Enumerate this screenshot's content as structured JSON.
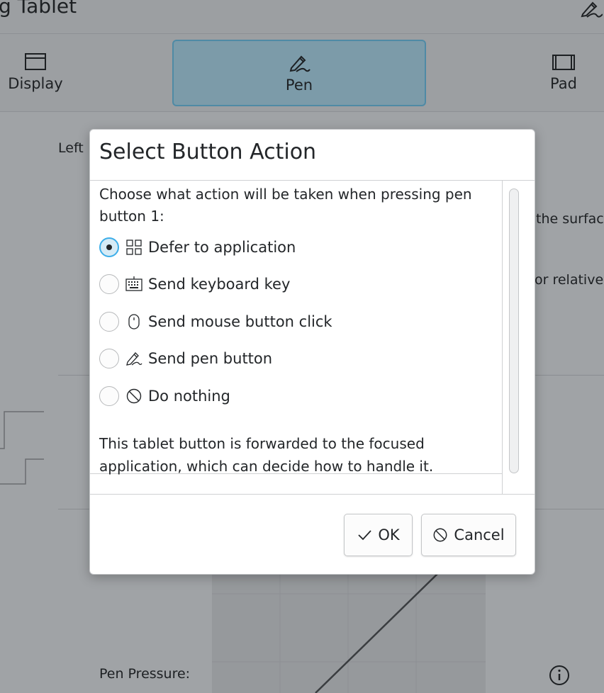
{
  "window": {
    "title": "g Tablet",
    "title_icon": "pen-icon"
  },
  "tabs": [
    {
      "label": "Display",
      "icon": "display-icon"
    },
    {
      "label": "Pen",
      "icon": "pen-icon",
      "selected": true
    },
    {
      "label": "Pad",
      "icon": "pad-icon"
    }
  ],
  "background": {
    "left_label": "Left",
    "surface_text": "the surfac",
    "relative_text": "or relative t",
    "pen_pressure_label": "Pen Pressure:"
  },
  "dialog": {
    "title": "Select Button Action",
    "prompt": "Choose what action will be taken when pressing pen button 1:",
    "options": [
      {
        "label": "Defer to application",
        "icon": "grid-icon",
        "checked": true
      },
      {
        "label": "Send keyboard key",
        "icon": "keyboard-icon",
        "checked": false
      },
      {
        "label": "Send mouse button click",
        "icon": "mouse-icon",
        "checked": false
      },
      {
        "label": "Send pen button",
        "icon": "pen-icon",
        "checked": false
      },
      {
        "label": "Do nothing",
        "icon": "cancel-icon",
        "checked": false
      }
    ],
    "description": "This tablet button is forwarded to the focused application, which can decide how to handle it.",
    "ok_label": "OK",
    "cancel_label": "Cancel"
  },
  "colors": {
    "accent": "#3daee9",
    "selected_tab": "#7c9ba9",
    "dim_background": "#a0a3a6"
  }
}
